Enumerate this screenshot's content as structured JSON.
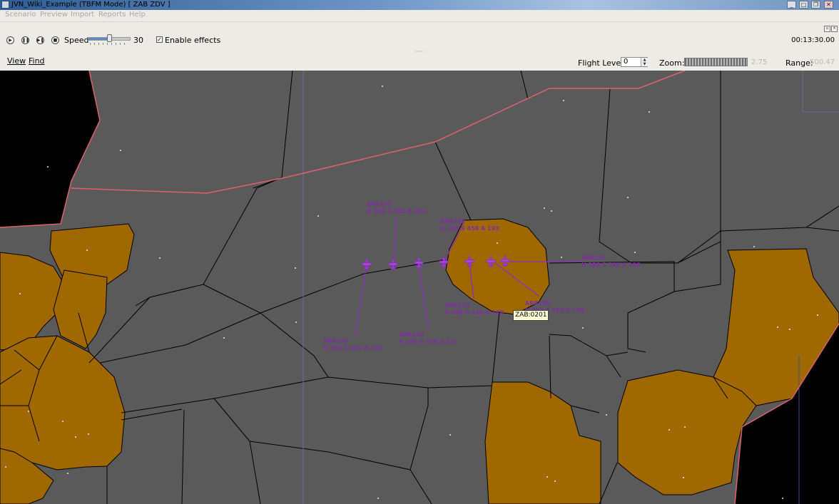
{
  "window": {
    "title": "JVN_Wiki_Example (TBFM Mode) [ ZAB ZDV ]"
  },
  "menubar": {
    "items": [
      "Scenario",
      "Preview",
      "Import",
      "Reports",
      "Help"
    ]
  },
  "toolbar": {
    "speed_label": "Speed",
    "speed_value": "30",
    "effects_label": "Enable effects",
    "effects_checked": true,
    "clock": "00:13:30.00"
  },
  "viewbar": {
    "view_label": "View",
    "find_label": "Find",
    "flight_level_label": "Flight Level:",
    "flight_level_value": "0",
    "zoom_label": "Zoom:",
    "zoom_value": "2.75",
    "range_label": "Range:",
    "range_value": "500.47"
  },
  "map": {
    "colors": {
      "background": "#5a5a5a",
      "airspace": "#a06800",
      "boundary": "#e06070",
      "aircraft": "#8a2dc0",
      "outside": "#000000"
    },
    "tooltip": "ZAB:0201",
    "aircraft": [
      {
        "id": "ARR101",
        "label_lines": [
          "ARR101",
          "H 288 S 458 A 243"
        ]
      },
      {
        "id": "ARR102",
        "label_lines": [
          "ARR102",
          "H 288 S 458 A 193"
        ]
      },
      {
        "id": "ARR107",
        "label_lines": [
          "ARR107",
          "H 288 S 388 A 198"
        ]
      },
      {
        "id": "ARR103",
        "label_lines": [
          "ARR103",
          "H 288 S 438 A 148"
        ]
      },
      {
        "id": "ARR108",
        "label_lines": [
          "ARR108",
          "H 288 S 318 A 100"
        ]
      },
      {
        "id": "ARR104",
        "label_lines": [
          "ARR104",
          "H 288 S 458 A 227"
        ]
      },
      {
        "id": "ARR105",
        "label_lines": [
          "ARR105",
          "H 288 S 458 A 240"
        ]
      }
    ]
  }
}
